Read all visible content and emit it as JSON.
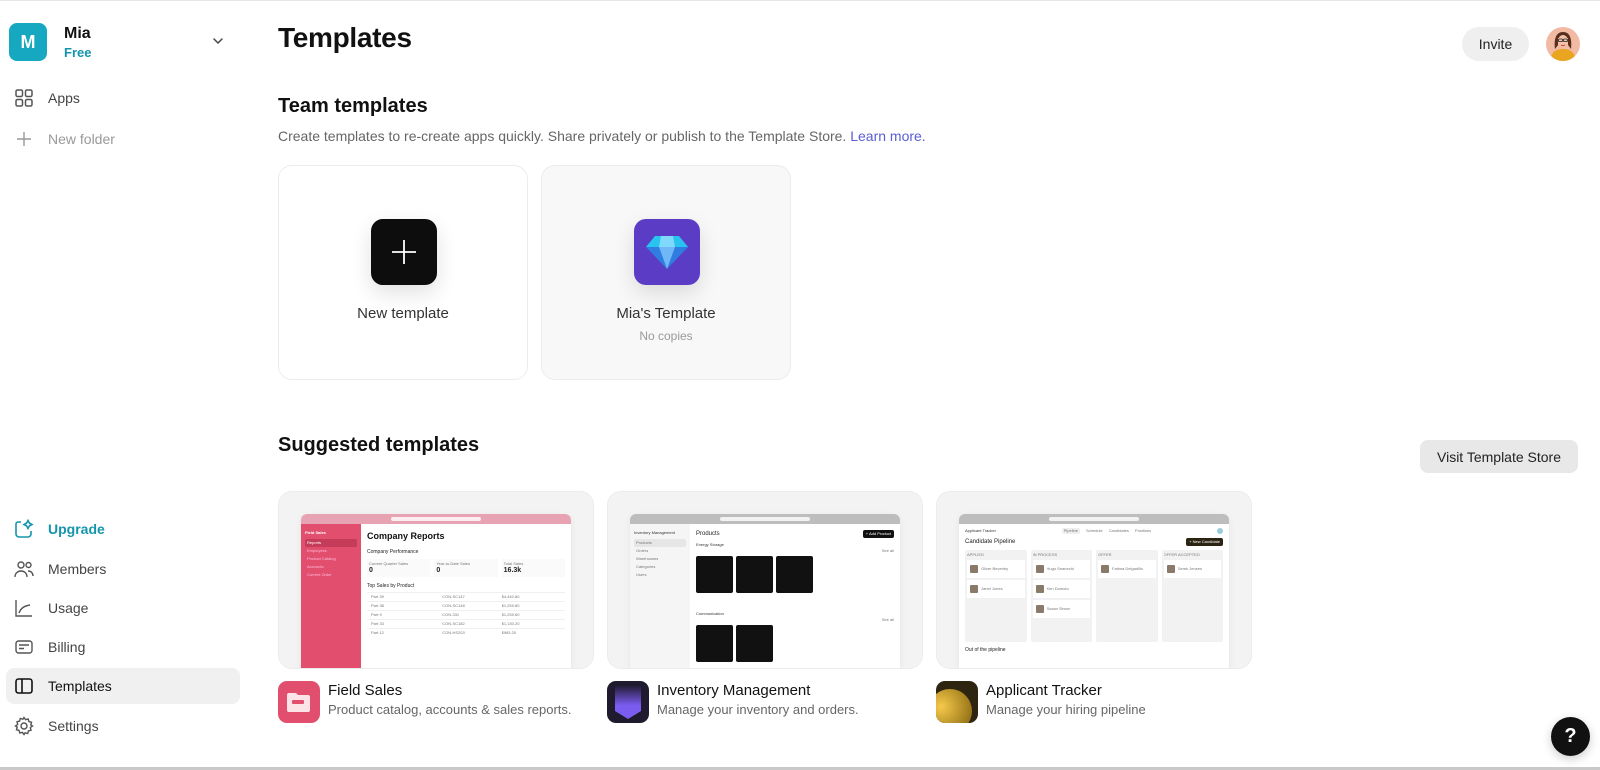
{
  "team": {
    "initial": "M",
    "name": "Mia",
    "plan": "Free",
    "color": "#15a8c0"
  },
  "sidebar": {
    "top_items": [
      {
        "label": "Apps",
        "icon": "grid-icon"
      },
      {
        "label": "New folder",
        "icon": "plus-icon"
      }
    ],
    "bottom_items": [
      {
        "label": "Upgrade",
        "icon": "upgrade-sparkle-icon"
      },
      {
        "label": "Members",
        "icon": "members-icon"
      },
      {
        "label": "Usage",
        "icon": "chart-line-icon"
      },
      {
        "label": "Billing",
        "icon": "credit-card-icon"
      },
      {
        "label": "Templates",
        "icon": "book-open-icon",
        "active": true
      },
      {
        "label": "Settings",
        "icon": "gear-icon"
      }
    ]
  },
  "header": {
    "title": "Templates",
    "invite_label": "Invite"
  },
  "team_templates": {
    "title": "Team templates",
    "description": "Create templates to re-create apps quickly. Share privately or publish to the Template Store.",
    "learn_more": "Learn more.",
    "cards": [
      {
        "label": "New template",
        "icon": "plus-icon"
      },
      {
        "label": "Mia's Template",
        "sub": "No copies",
        "icon": "diamond-icon",
        "color": "#5b3cc4"
      }
    ]
  },
  "suggested": {
    "title": "Suggested templates",
    "store_button": "Visit Template Store",
    "items": [
      {
        "name": "Field Sales",
        "description": "Product catalog, accounts & sales reports.",
        "color": "#e24f6e",
        "preview": {
          "app": "Field Sales",
          "nav": [
            "Reports",
            "Employees",
            "Product Catalog",
            "Accounts",
            "Current Order"
          ],
          "title": "Company Reports",
          "section": "Company Performance",
          "stats": [
            {
              "label": "Current Quarter Sales",
              "value": "0"
            },
            {
              "label": "Year-to-Date Sales",
              "value": "0"
            },
            {
              "label": "Total Sales",
              "value": "16.3k"
            }
          ],
          "table_title": "Top Sales by Product",
          "rows": [
            [
              "Part 39",
              "CON-SC147",
              "$4,440.80"
            ],
            [
              "Part 38",
              "CON-SC148",
              "$1,259.80"
            ],
            [
              "Part 9",
              "CON-331",
              "$1,259.60"
            ],
            [
              "Part 33",
              "CON-SC182",
              "$1,130.20"
            ],
            [
              "Part 12",
              "CON-HS203",
              "$983.20"
            ]
          ]
        }
      },
      {
        "name": "Inventory Management",
        "description": "Manage your inventory and orders.",
        "color": "#2a2340",
        "preview": {
          "app": "Inventory Management",
          "nav": [
            "Products",
            "Orders",
            "Warehouses",
            "Categories",
            "Users"
          ],
          "title": "Products",
          "add_button": "+ Add Product",
          "sections": [
            "Energy Storage",
            "Communication"
          ],
          "see_all": "See all"
        }
      },
      {
        "name": "Applicant Tracker",
        "description": "Manage your hiring pipeline",
        "color": "#3a2e0c",
        "preview": {
          "app": "Applicant Tracker",
          "tabs": [
            "Pipeline",
            "Schedule",
            "Candidates",
            "Positions"
          ],
          "title": "Candidate Pipeline",
          "add_button": "+ New Candidate",
          "columns": [
            {
              "name": "APPLIED",
              "cards": [
                "Oliver Beverley",
                "Janet Jones"
              ]
            },
            {
              "name": "IN PROCESS",
              "cards": [
                "Hugo Seanechi",
                "Ken Domoto",
                "Susan Simon"
              ]
            },
            {
              "name": "OFFER",
              "cards": [
                "Fatima Delgadillo"
              ]
            },
            {
              "name": "OFFER ACCEPTED",
              "cards": [
                "Derek Jensen"
              ]
            }
          ],
          "footer": "Out of the pipeline"
        }
      }
    ]
  },
  "help": {
    "label": "?"
  }
}
